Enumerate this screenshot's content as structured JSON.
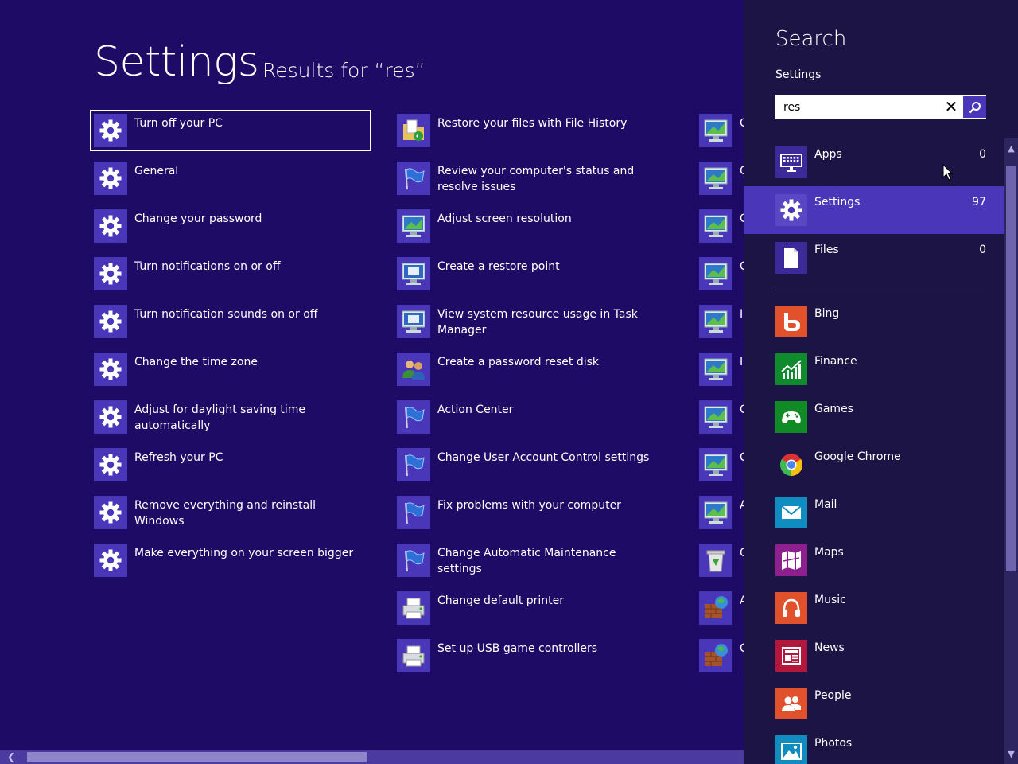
{
  "page": {
    "title": "Settings",
    "subtitle": "Results for “res”"
  },
  "results": {
    "column1": [
      {
        "label": "Turn off your PC",
        "icon": "gear-icon",
        "selected": true
      },
      {
        "label": "General",
        "icon": "gear-icon"
      },
      {
        "label": "Change your password",
        "icon": "gear-icon"
      },
      {
        "label": "Turn notifications on or off",
        "icon": "gear-icon"
      },
      {
        "label": "Turn notification sounds on or off",
        "icon": "gear-icon"
      },
      {
        "label": "Change the time zone",
        "icon": "gear-icon"
      },
      {
        "label": "Adjust for daylight saving time automatically",
        "icon": "gear-icon"
      },
      {
        "label": "Refresh your PC",
        "icon": "gear-icon"
      },
      {
        "label": "Remove everything and reinstall Windows",
        "icon": "gear-icon"
      },
      {
        "label": "Make everything on your screen bigger",
        "icon": "gear-icon"
      }
    ],
    "column2": [
      {
        "label": "Restore your files with File History",
        "icon": "file-history-icon"
      },
      {
        "label": "Review your computer's status and resolve issues",
        "icon": "action-center-flag-icon"
      },
      {
        "label": "Adjust screen resolution",
        "icon": "display-icon"
      },
      {
        "label": "Create a restore point",
        "icon": "system-icon"
      },
      {
        "label": "View system resource usage in Task Manager",
        "icon": "system-icon"
      },
      {
        "label": "Create a password reset disk",
        "icon": "users-icon"
      },
      {
        "label": "Action Center",
        "icon": "action-center-flag-icon"
      },
      {
        "label": "Change User Account Control settings",
        "icon": "action-center-flag-icon"
      },
      {
        "label": "Fix problems with your computer",
        "icon": "action-center-flag-icon"
      },
      {
        "label": "Change Automatic Maintenance settings",
        "icon": "action-center-flag-icon"
      },
      {
        "label": "Change default printer",
        "icon": "printer-icon"
      },
      {
        "label": "Set up USB game controllers",
        "icon": "printer-icon"
      }
    ],
    "column3": [
      {
        "label": "C",
        "icon": "display-icon"
      },
      {
        "label": "C",
        "icon": "display-icon"
      },
      {
        "label": "C",
        "icon": "display-icon"
      },
      {
        "label": "C",
        "icon": "display-icon"
      },
      {
        "label": "I",
        "icon": "display-icon"
      },
      {
        "label": "I",
        "icon": "display-icon"
      },
      {
        "label": "C",
        "icon": "display-icon"
      },
      {
        "label": "C",
        "icon": "display-icon"
      },
      {
        "label": "A",
        "icon": "display-icon"
      },
      {
        "label": "C",
        "icon": "recycle-icon"
      },
      {
        "label": "A",
        "icon": "firewall-icon"
      },
      {
        "label": "C",
        "icon": "firewall-icon"
      }
    ]
  },
  "search": {
    "heading": "Search",
    "scope_label": "Settings",
    "query": "res",
    "clear_glyph": "✕",
    "scopes": [
      {
        "name": "Apps",
        "count": "0",
        "icon": "keyboard-icon",
        "active": false
      },
      {
        "name": "Settings",
        "count": "97",
        "icon": "gear-icon",
        "active": true
      },
      {
        "name": "Files",
        "count": "0",
        "icon": "file-icon",
        "active": false
      }
    ],
    "apps": [
      {
        "name": "Bing",
        "color": "#e0512c",
        "icon": "bing-icon"
      },
      {
        "name": "Finance",
        "color": "#0f8a2c",
        "icon": "finance-icon"
      },
      {
        "name": "Games",
        "color": "#108a24",
        "icon": "games-icon"
      },
      {
        "name": "Google Chrome",
        "color": "#1d1446",
        "icon": "chrome-icon"
      },
      {
        "name": "Mail",
        "color": "#0f8cc0",
        "icon": "mail-icon"
      },
      {
        "name": "Maps",
        "color": "#8d1f8e",
        "icon": "maps-icon"
      },
      {
        "name": "Music",
        "color": "#e0512c",
        "icon": "music-icon"
      },
      {
        "name": "News",
        "color": "#b3173c",
        "icon": "news-icon"
      },
      {
        "name": "People",
        "color": "#e0512c",
        "icon": "people-icon"
      },
      {
        "name": "Photos",
        "color": "#0f8cc0",
        "icon": "photos-icon"
      }
    ]
  },
  "colors": {
    "background": "#1e0b66",
    "accent": "#4a36b8",
    "pane": "#1d1446"
  }
}
